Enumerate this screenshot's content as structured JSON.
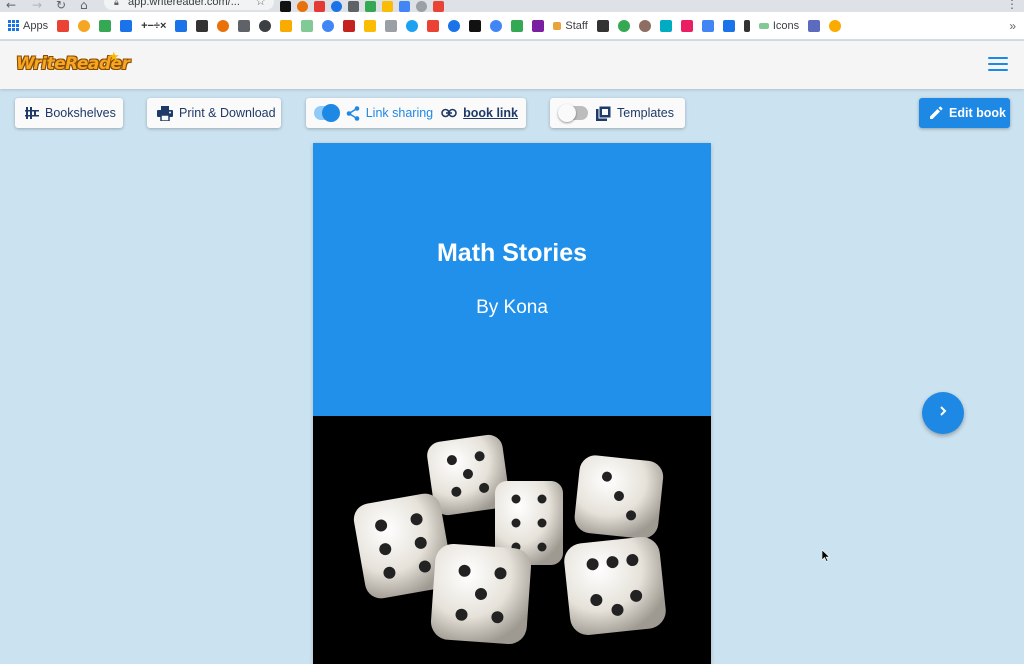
{
  "browser": {
    "url": "app.writereader.com/...",
    "bookmarks": {
      "apps_label": "Apps",
      "staff_label": "Staff",
      "icons_label": "Icons"
    }
  },
  "header": {
    "logo_text": "WriteReader"
  },
  "toolbar": {
    "bookshelves_label": "Bookshelves",
    "print_label": "Print & Download",
    "link_sharing_label": "Link sharing",
    "link_sharing_enabled": true,
    "book_link_label": "book link",
    "templates_label": "Templates",
    "templates_enabled": false,
    "edit_label": "Edit book"
  },
  "book": {
    "title": "Math Stories",
    "author": "By Kona",
    "cover_color": "#2090ea",
    "image_subject": "white dice on black background"
  },
  "colors": {
    "background": "#cbe2f0",
    "accent": "#1e88e5",
    "text_dark": "#1f3a68"
  }
}
